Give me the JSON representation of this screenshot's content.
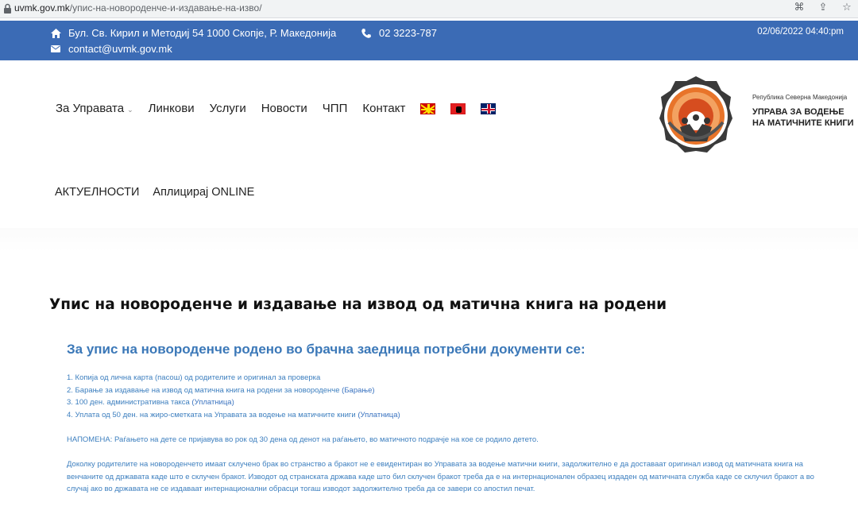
{
  "browser": {
    "url_host": "uvmk.gov.mk",
    "url_path": "/упис-на-новороденче-и-издавање-на-изво/"
  },
  "topbar": {
    "address": "Бул. Св. Кирил и Методиј 54 1000 Скопје, Р. Македонија",
    "phone": "02 3223-787",
    "email": "contact@uvmk.gov.mk",
    "datetime": "02/06/2022 04:40:pm",
    "color": "#3b6bb5"
  },
  "nav": {
    "primary": [
      "За Управата",
      "Линкови",
      "Услуги",
      "Новости",
      "ЧПП",
      "Контакт"
    ],
    "secondary": [
      "АКТУЕЛНОСТИ",
      "Аплицирај ONLINE"
    ],
    "languages": [
      "mk-flag-icon",
      "al-flag-icon",
      "uk-flag-icon"
    ]
  },
  "logo": {
    "small": "Република Северна Македонија",
    "line1": "УПРАВА ЗА ВОДЕЊЕ",
    "line2": "НА МАТИЧНИТЕ КНИГИ"
  },
  "content": {
    "title": "Упис на новороденче и издавање на извод од матична книга на родени",
    "subtitle": "За упис на новороденче родено во брачна заедница потребни документи се:",
    "items": [
      {
        "text": "1. Копија од лична карта (пасош) од родителите и оригинал за проверка",
        "link": ""
      },
      {
        "text": "2. Барање за издавање на извод од матична книга на родени за новороденче ",
        "link": "(Барање)"
      },
      {
        "text": "3. 100 ден. административна такса ",
        "link": "(Уплатница)"
      },
      {
        "text": "4. Уплата од 50 ден. на жиро-сметката на Управата за водење на матичните книги ",
        "link": "(Уплатница)"
      }
    ],
    "note": "НАПОМЕНА: Раѓањето на дете се пријавува во рок од 30 дена од денот на раѓањето, во матичното подрачје на кое се родило детето.",
    "paragraph": "Доколку родителите на новороденчето имаат склучено брак во странство а бракот не е евидентиран во Управата за водење матични книги, задолжително е да доставаат оригинал извод од матичната книга на венчаните од државата каде што е склучен бракот. Изводот од странската држава каде што бил склучен бракот треба да е на интернационален образец издаден од матичната служба каде се склучил бракот а во случај ако во државата не се издаваат интернационални обрасци тогаш изводот задолжително треба да се завери со апостил печат.",
    "text_color": "#3d7fbf",
    "subtitle_color": "#3b78b8"
  }
}
